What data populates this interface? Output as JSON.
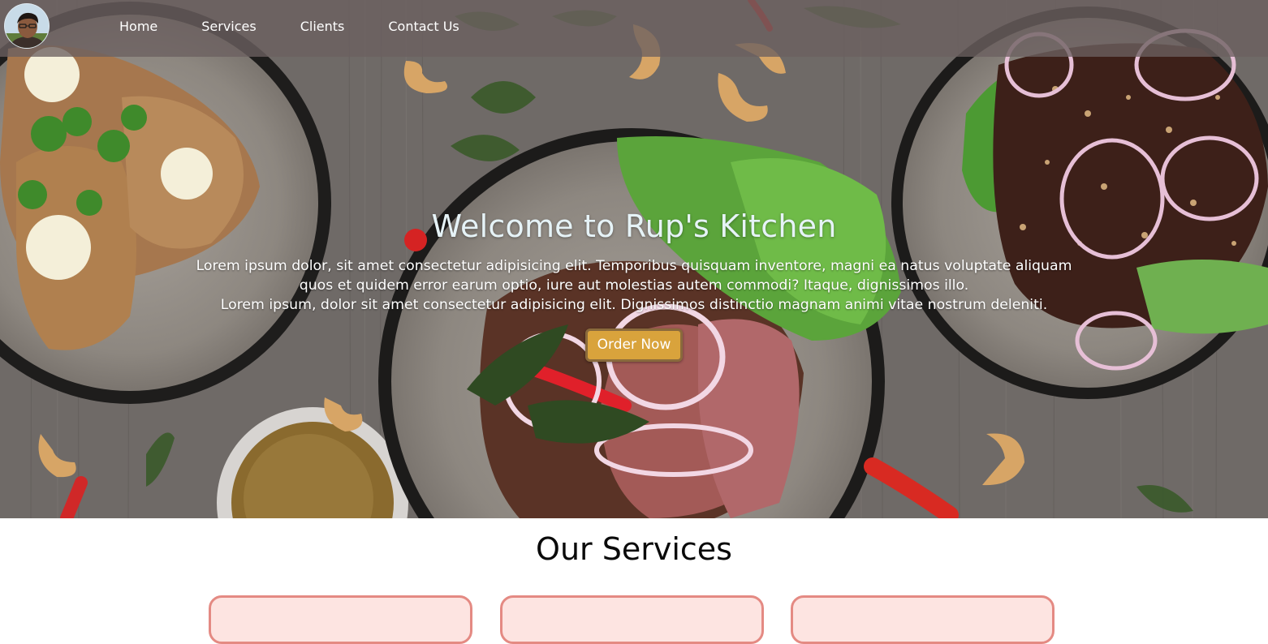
{
  "nav": {
    "links": [
      "Home",
      "Services",
      "Clients",
      "Contact Us"
    ]
  },
  "hero": {
    "title": "Welcome to Rup's Kitchen",
    "description_lines": [
      "Lorem ipsum dolor, sit amet consectetur adipisicing elit. Temporibus quisquam inventore, magni ea natus voluptate aliquam",
      "quos et quidem error earum optio, iure aut molestias autem commodi? Itaque, dignissimos illo.",
      "Lorem ipsum, dolor sit amet consectetur adipisicing elit. Dignissimos distinctio magnam animi vitae nostrum deleniti."
    ],
    "button_label": "Order Now"
  },
  "services": {
    "title": "Our Services",
    "cards": [
      "",
      "",
      ""
    ]
  },
  "colors": {
    "navbar": "#6c6060",
    "button": "#d9a33c",
    "card_fill": "#fde4e1",
    "card_border": "#e48a83",
    "hero_title": "#e6f3f7"
  },
  "icons": {
    "avatar": "profile-photo"
  }
}
